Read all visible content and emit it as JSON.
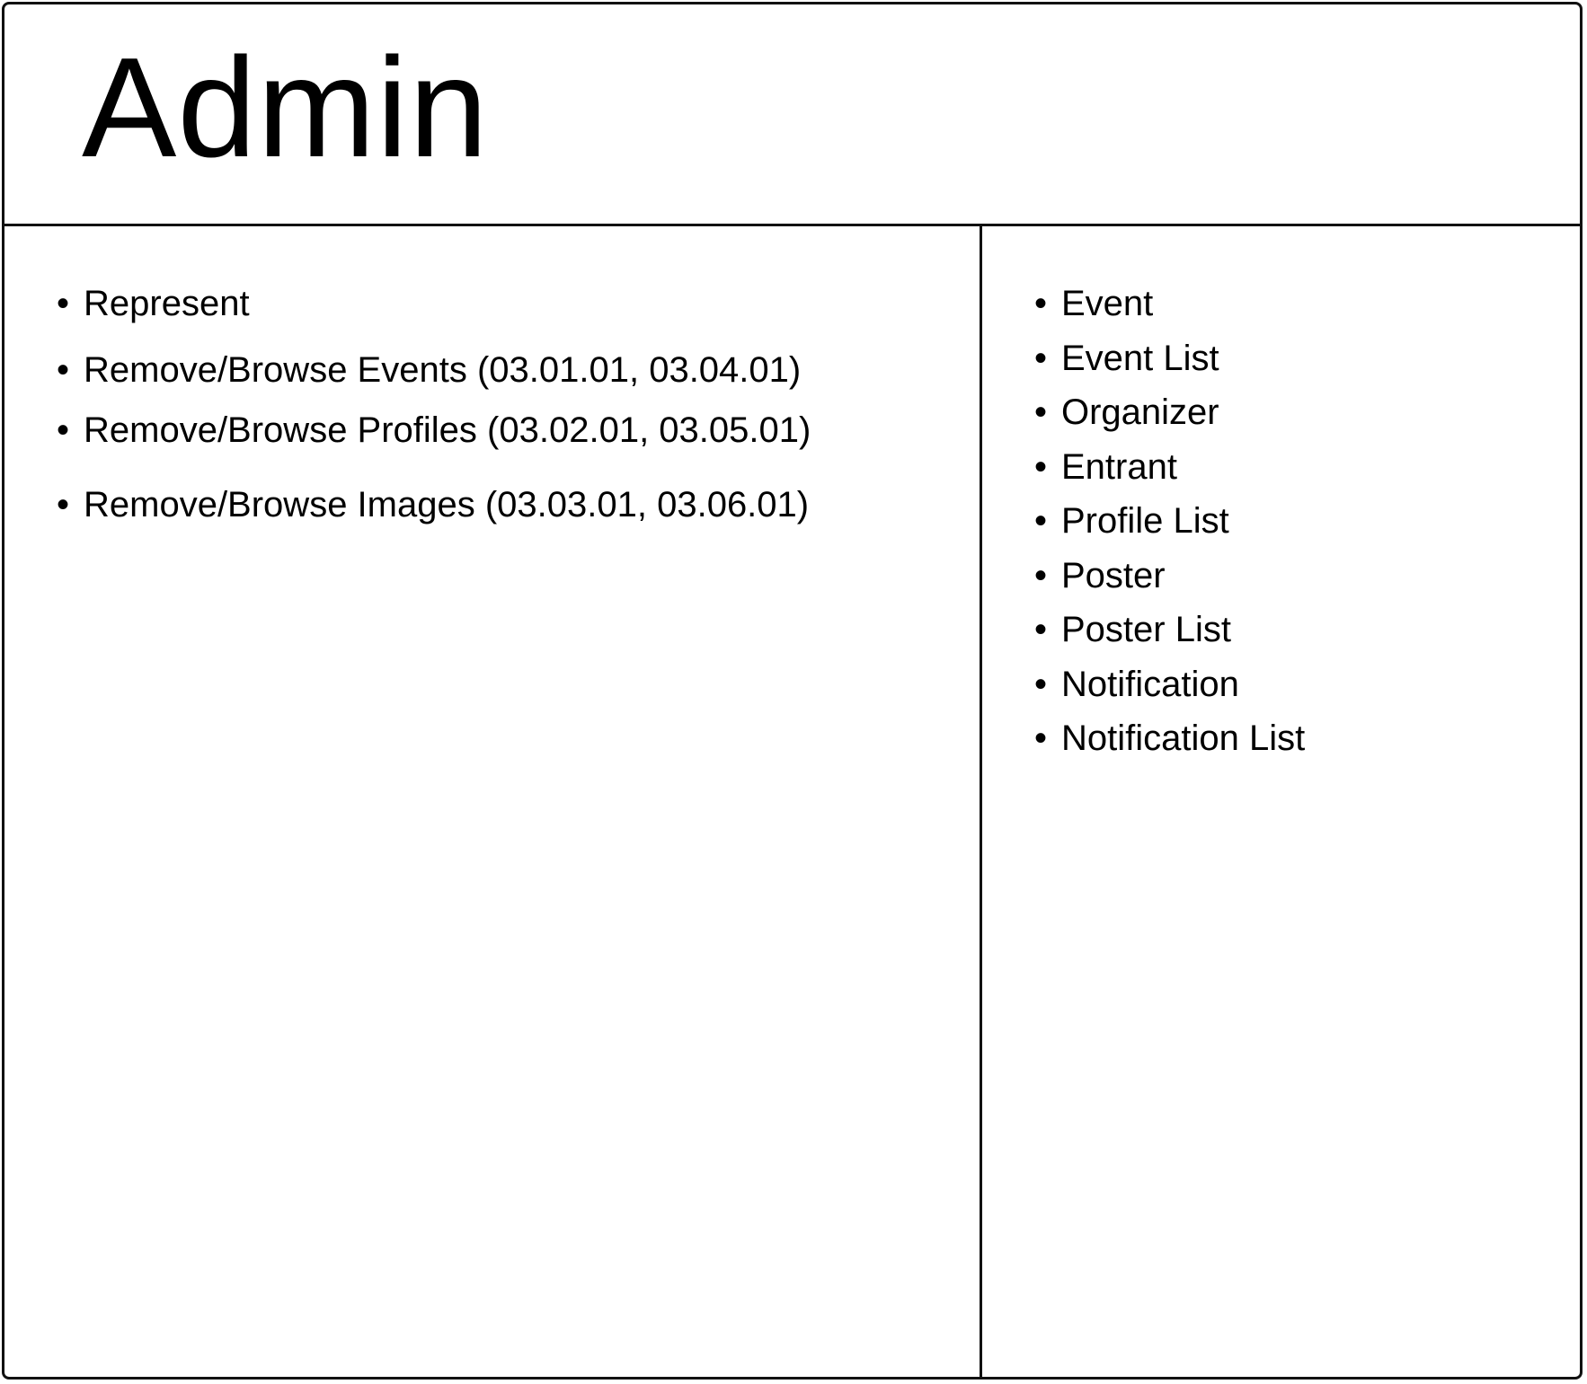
{
  "card": {
    "title": "Admin",
    "responsibilities": [
      {
        "label": "Represent"
      },
      {
        "label": "Remove/Browse Events (03.01.01, 03.04.01)"
      },
      {
        "label": "Remove/Browse Profiles (03.02.01, 03.05.01)"
      },
      {
        "label": "Remove/Browse Images (03.03.01, 03.06.01)"
      }
    ],
    "collaborators": [
      {
        "label": "Event"
      },
      {
        "label": "Event List"
      },
      {
        "label": "Organizer"
      },
      {
        "label": "Entrant"
      },
      {
        "label": "Profile List"
      },
      {
        "label": "Poster"
      },
      {
        "label": "Poster List"
      },
      {
        "label": "Notification"
      },
      {
        "label": "Notification List"
      }
    ]
  },
  "colors": {
    "border": "#111111",
    "text": "#000000",
    "background": "#ffffff"
  }
}
